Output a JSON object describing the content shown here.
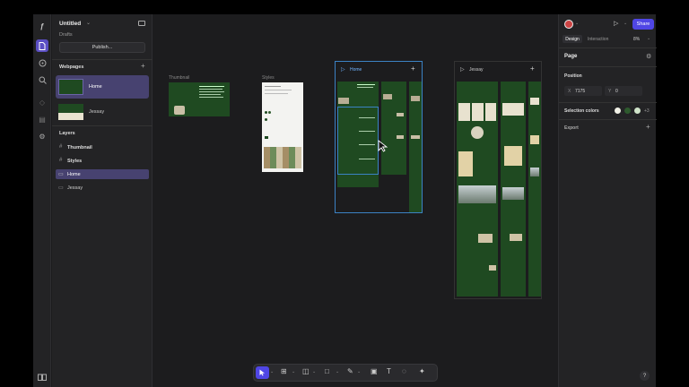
{
  "app": {
    "project_title": "Untitled",
    "project_location": "Drafts",
    "publish_label": "Publish..."
  },
  "rail": {
    "icons": [
      "logo-icon",
      "pages-icon",
      "assets-icon",
      "search-icon",
      "components-icon",
      "cms-icon",
      "settings-icon",
      "help-book-icon"
    ]
  },
  "webpages": {
    "title": "Webpages",
    "items": [
      {
        "label": "Home"
      },
      {
        "label": "Jessay"
      }
    ]
  },
  "layers": {
    "title": "Layers",
    "items": [
      {
        "label": "Thumbnail"
      },
      {
        "label": "Styles"
      },
      {
        "label": "Home"
      },
      {
        "label": "Jessay"
      }
    ]
  },
  "canvas": {
    "frames": [
      {
        "label": "Thumbnail"
      },
      {
        "label": "Styles"
      },
      {
        "label": "Home"
      },
      {
        "label": "Jessay"
      }
    ]
  },
  "right": {
    "tabs": [
      "Design",
      "Interaction"
    ],
    "zoom": "8%",
    "share_label": "Share",
    "page_title": "Page",
    "position_title": "Position",
    "x_label": "X",
    "x_value": "7175",
    "y_label": "Y",
    "y_value": "0",
    "selection_colors_title": "Selection colors",
    "selection_colors_more": "+3",
    "selection_colors": [
      "#f1f1e6",
      "#2e5a2e",
      "#cfe3c9"
    ],
    "export_title": "Export",
    "help_label": "?"
  },
  "colors": {
    "accent": "#4f46e5",
    "selection": "#3b82c4",
    "site_green": "#1f4a21"
  }
}
